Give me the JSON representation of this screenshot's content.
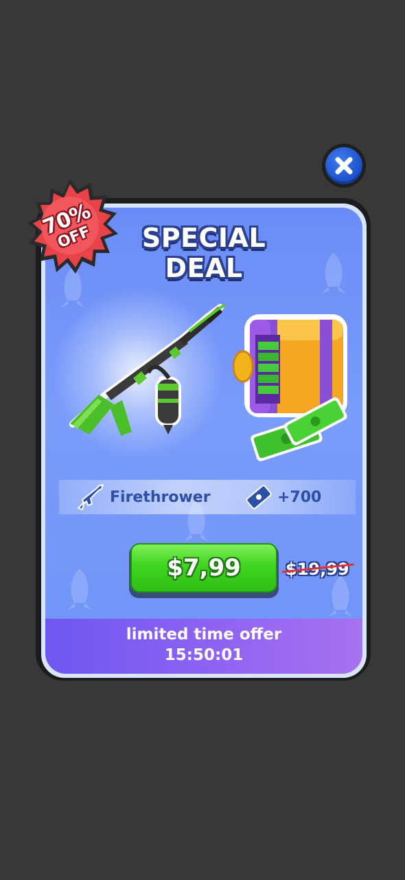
{
  "popup": {
    "title_line1": "SPECIAL",
    "title_line2": "DEAL",
    "badge": {
      "percent": "70%",
      "off": "OFF"
    },
    "rewards": [
      {
        "icon": "rifle-icon",
        "label": "Firethrower"
      },
      {
        "icon": "cash-icon",
        "label": "+700"
      }
    ],
    "price": "$7,99",
    "old_price": "$19,99",
    "footer": {
      "label": "limited time offer",
      "timer": "15:50:01"
    }
  },
  "colors": {
    "background": "#383838",
    "card": "#7a9cfa",
    "buy_button": "#3fd420",
    "badge": "#e8424a",
    "footer": "#8f63f2",
    "close_button": "#2a62e0"
  }
}
